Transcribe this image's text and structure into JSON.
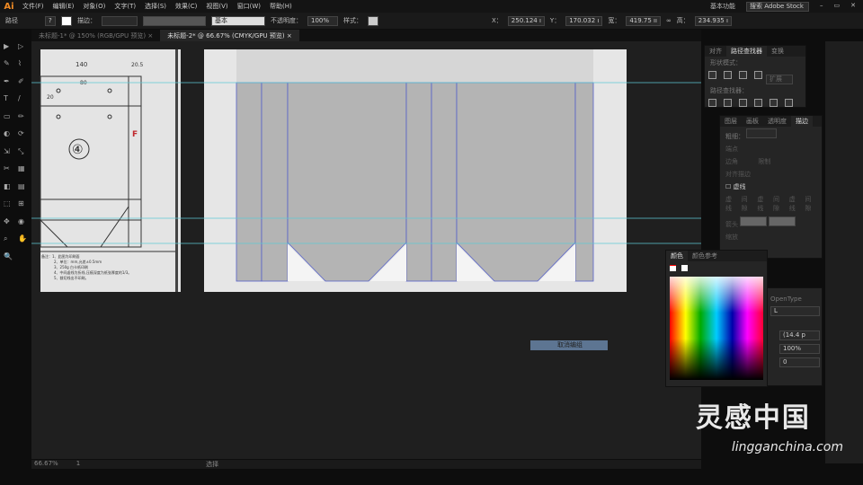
{
  "app": {
    "logo": "Ai",
    "menu": [
      "文件(F)",
      "编辑(E)",
      "对象(O)",
      "文字(T)",
      "选择(S)",
      "效果(C)",
      "视图(V)",
      "窗口(W)",
      "帮助(H)"
    ],
    "workspace": "基本功能",
    "search_placeholder": "搜索 Adobe Stock"
  },
  "control": {
    "selection": "路径",
    "stroke_label": "描边：",
    "stroke_style": "基本",
    "opacity_label": "不透明度：",
    "opacity": "100%",
    "style_label": "样式：",
    "x_label": "X：",
    "x": "250.124 ı",
    "y_label": "Y：",
    "y": "170.032 ı",
    "w_label": "宽：",
    "w": "419.75 ıı",
    "h_label": "高：",
    "h": "234.935 ı"
  },
  "tabs": [
    {
      "label": "未标题-1* @ 150% (RGB/GPU 预览)",
      "close": "×"
    },
    {
      "label": "未标题-2* @ 66.67% (CMYK/GPU 预览)",
      "close": "×"
    }
  ],
  "drawing": {
    "dim1": "140",
    "dim2": "20.5",
    "dim3": "80",
    "dim4": "20",
    "number": "④",
    "mark": "F",
    "notes": [
      "备注：1、此图为印刷面",
      "2、单位：mm,允差±0.5mm",
      "3、250g 白卡纸印刷",
      "4、中间虚线为折线,压痕深度为纸张厚度的1/3。",
      "5、裁切线出不印刷。"
    ]
  },
  "pathfinder": {
    "tabs": [
      "对齐",
      "路径查找器",
      "变换"
    ],
    "shape_modes": "形状模式：",
    "expand": "扩展",
    "pathfinders": "路径查找器："
  },
  "stroke": {
    "tabs": [
      "图层",
      "画板",
      "透明度",
      "描边"
    ],
    "weight": "粗细：",
    "cap": "端点",
    "corner": "边角",
    "limit": "限制",
    "align": "对齐描边",
    "dashed": "虚线",
    "dash_labels": [
      "虚线",
      "间隙",
      "虚线",
      "间隙",
      "虚线",
      "间隙"
    ],
    "arrow": "箭头",
    "scale": "缩放"
  },
  "color": {
    "tabs": [
      "颜色",
      "颜色参考"
    ]
  },
  "char": {
    "opentype": "OpenType",
    "style": "L",
    "leading": "(14.4 p",
    "scale": "100%",
    "tracking": "0"
  },
  "tooltip": "取消编组",
  "status": {
    "zoom": "66.67%",
    "page": "1",
    "tool": "选择"
  },
  "watermark": {
    "brand": "灵感中国",
    "url": "lingganchina.com"
  }
}
